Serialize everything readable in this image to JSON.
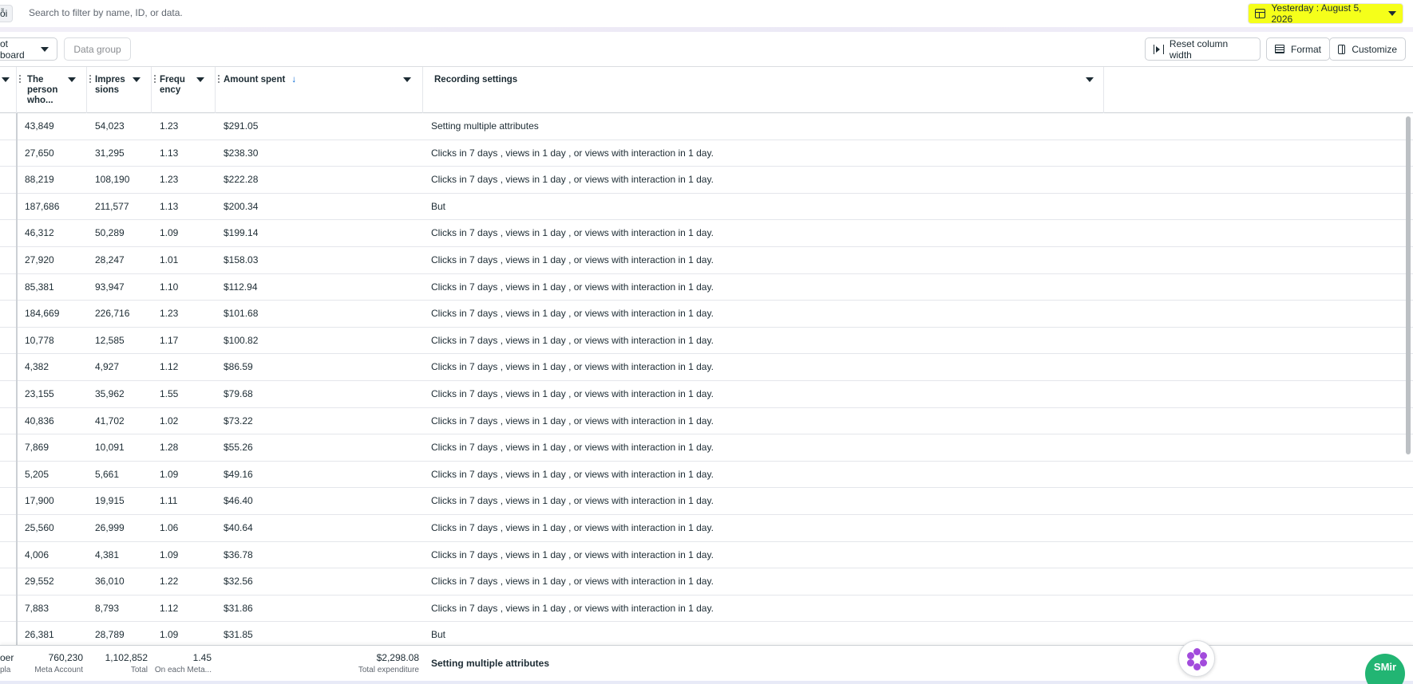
{
  "topbar": {
    "cut_chip": "ỗi",
    "search_placeholder": "Search to filter by name, ID, or data.",
    "date_range": "Yesterday : August 5, 2026",
    "date_highlight_color": "#f5ff1a"
  },
  "toolbar": {
    "board_label": "ot board",
    "data_group_label": "Data group",
    "reset_label": "Reset column width",
    "format_label": "Format",
    "customize_label": "Customize"
  },
  "columns": {
    "people": "The person who...",
    "impressions": "Impres sions",
    "frequency": "Frequ ency",
    "amount": "Amount spent",
    "amount_sort_icon": "arrow-down-icon",
    "recording": "Recording settings"
  },
  "rows": [
    {
      "people": "43,849",
      "impressions": "54,023",
      "frequency": "1.23",
      "amount": "$291.05",
      "setting": "Setting multiple attributes"
    },
    {
      "people": "27,650",
      "impressions": "31,295",
      "frequency": "1.13",
      "amount": "$238.30",
      "setting": "Clicks in 7 days , views in 1 day , or views with interaction in 1 day."
    },
    {
      "people": "88,219",
      "impressions": "108,190",
      "frequency": "1.23",
      "amount": "$222.28",
      "setting": "Clicks in 7 days , views in 1 day , or views with interaction in 1 day."
    },
    {
      "people": "187,686",
      "impressions": "211,577",
      "frequency": "1.13",
      "amount": "$200.34",
      "setting": "But"
    },
    {
      "people": "46,312",
      "impressions": "50,289",
      "frequency": "1.09",
      "amount": "$199.14",
      "setting": "Clicks in 7 days , views in 1 day , or views with interaction in 1 day."
    },
    {
      "people": "27,920",
      "impressions": "28,247",
      "frequency": "1.01",
      "amount": "$158.03",
      "setting": "Clicks in 7 days , views in 1 day , or views with interaction in 1 day."
    },
    {
      "people": "85,381",
      "impressions": "93,947",
      "frequency": "1.10",
      "amount": "$112.94",
      "setting": "Clicks in 7 days , views in 1 day , or views with interaction in 1 day."
    },
    {
      "people": "184,669",
      "impressions": "226,716",
      "frequency": "1.23",
      "amount": "$101.68",
      "setting": "Clicks in 7 days , views in 1 day , or views with interaction in 1 day."
    },
    {
      "people": "10,778",
      "impressions": "12,585",
      "frequency": "1.17",
      "amount": "$100.82",
      "setting": "Clicks in 7 days , views in 1 day , or views with interaction in 1 day."
    },
    {
      "people": "4,382",
      "impressions": "4,927",
      "frequency": "1.12",
      "amount": "$86.59",
      "setting": "Clicks in 7 days , views in 1 day , or views with interaction in 1 day."
    },
    {
      "people": "23,155",
      "impressions": "35,962",
      "frequency": "1.55",
      "amount": "$79.68",
      "setting": "Clicks in 7 days , views in 1 day , or views with interaction in 1 day."
    },
    {
      "people": "40,836",
      "impressions": "41,702",
      "frequency": "1.02",
      "amount": "$73.22",
      "setting": "Clicks in 7 days , views in 1 day , or views with interaction in 1 day."
    },
    {
      "people": "7,869",
      "impressions": "10,091",
      "frequency": "1.28",
      "amount": "$55.26",
      "setting": "Clicks in 7 days , views in 1 day , or views with interaction in 1 day."
    },
    {
      "people": "5,205",
      "impressions": "5,661",
      "frequency": "1.09",
      "amount": "$49.16",
      "setting": "Clicks in 7 days , views in 1 day , or views with interaction in 1 day."
    },
    {
      "people": "17,900",
      "impressions": "19,915",
      "frequency": "1.11",
      "amount": "$46.40",
      "setting": "Clicks in 7 days , views in 1 day , or views with interaction in 1 day."
    },
    {
      "people": "25,560",
      "impressions": "26,999",
      "frequency": "1.06",
      "amount": "$40.64",
      "setting": "Clicks in 7 days , views in 1 day , or views with interaction in 1 day."
    },
    {
      "people": "4,006",
      "impressions": "4,381",
      "frequency": "1.09",
      "amount": "$36.78",
      "setting": "Clicks in 7 days , views in 1 day , or views with interaction in 1 day."
    },
    {
      "people": "29,552",
      "impressions": "36,010",
      "frequency": "1.22",
      "amount": "$32.56",
      "setting": "Clicks in 7 days , views in 1 day , or views with interaction in 1 day."
    },
    {
      "people": "7,883",
      "impressions": "8,793",
      "frequency": "1.12",
      "amount": "$31.86",
      "setting": "Clicks in 7 days , views in 1 day , or views with interaction in 1 day."
    },
    {
      "people": "26,381",
      "impressions": "28,789",
      "frequency": "1.09",
      "amount": "$31.85",
      "setting": "But"
    }
  ],
  "footer": {
    "cut_value": "oer",
    "cut_label": "pla",
    "people_total": "760,230",
    "people_label": "Meta Account",
    "impressions_total": "1,102,852",
    "impressions_label": "Total",
    "frequency_total": "1.45",
    "frequency_label": "On each Meta...",
    "amount_total": "$2,298.08",
    "amount_label": "Total expenditure",
    "setting_total": "Setting multiple attributes"
  },
  "widgets": {
    "assistant_icon": "flower-icon",
    "chat_label": "SMir",
    "chat_color": "#22b573"
  }
}
